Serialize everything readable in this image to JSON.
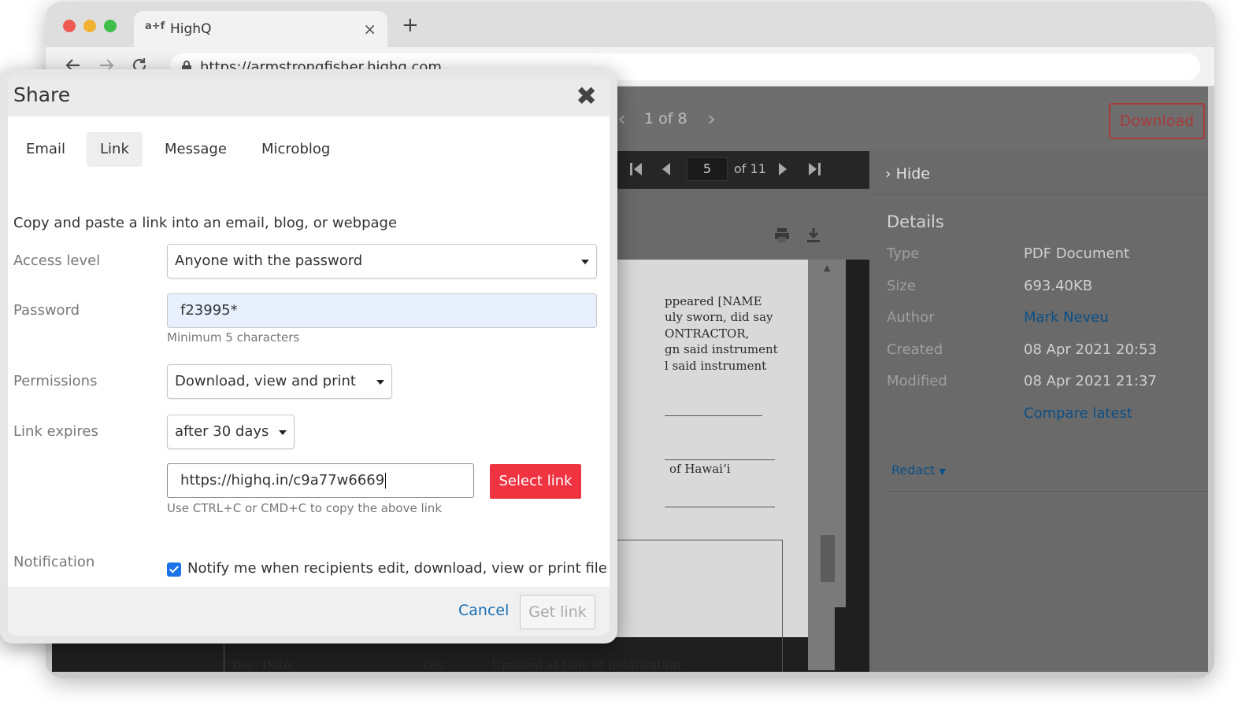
{
  "browser": {
    "tab_logo": "a+f",
    "tab_title": "HighQ",
    "close_glyph": "×",
    "newtab_glyph": "+",
    "url": "https://armstrongfisher.highq.com"
  },
  "app": {
    "pager": "1 of 8",
    "download_label": "Download",
    "page_current": "5",
    "page_total": "of 11",
    "hide_label": "Hide",
    "details_title": "Details",
    "details": [
      {
        "label": "Type",
        "value": "PDF Document"
      },
      {
        "label": "Size",
        "value": "693.40KB"
      },
      {
        "label": "Author",
        "value": "Mark Neveu"
      },
      {
        "label": "Created",
        "value": "08 Apr 2021 20:53"
      },
      {
        "label": "Modified",
        "value": "08 Apr 2021 21:37"
      }
    ],
    "compare_latest": "Compare latest",
    "redact_label": "Redact",
    "doc_lines": [
      "ppeared [NAME",
      "uly sworn, did say",
      "ONTRACTOR,",
      "gn said instrument",
      "l said instrument",
      "of Hawaiʻi",
      "Doc. Date:",
      "OR",
      "Undated at time of notarization"
    ]
  },
  "modal": {
    "title": "Share",
    "close_glyph": "✖",
    "tabs": [
      "Email",
      "Link",
      "Message",
      "Microblog"
    ],
    "active_tab": "Link",
    "intro": "Copy and paste a link into an email, blog, or webpage",
    "access_level_label": "Access level",
    "access_level_value": "Anyone with the password",
    "password_label": "Password",
    "password_value": "f23995*",
    "password_hint": "Minimum 5 characters",
    "permissions_label": "Permissions",
    "permissions_value": "Download, view and print",
    "link_expires_label": "Link expires",
    "link_expires_value": "after 30 days",
    "link_value": "https://highq.in/c9a77w6669",
    "select_link_label": "Select link",
    "link_hint": "Use CTRL+C or CMD+C to copy the above link",
    "notification_label": "Notification",
    "notify_text": "Notify me when recipients edit, download, view or print file",
    "notify_checked": true,
    "cancel_label": "Cancel",
    "get_link_label": "Get link"
  },
  "colors": {
    "accent_red": "#ef3340",
    "link_blue": "#1a6fb3",
    "checkbox_blue": "#1a73e8"
  }
}
